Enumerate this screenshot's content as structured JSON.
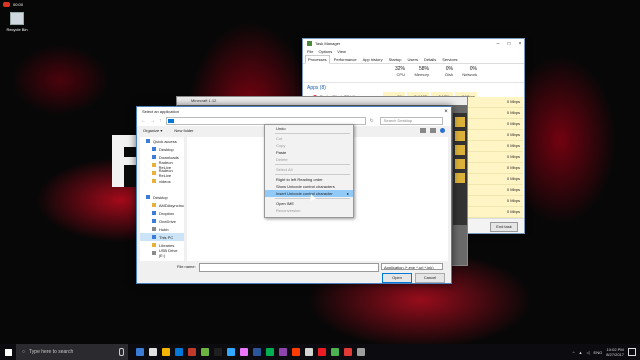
{
  "desktop": {
    "recorder_label": "00:00",
    "recycle_bin_label": "Recycle Bin"
  },
  "task_manager": {
    "title": "Task Manager",
    "menu": [
      "File",
      "Options",
      "View"
    ],
    "tabs": [
      "Processes",
      "Performance",
      "App history",
      "Startup",
      "Users",
      "Details",
      "Services"
    ],
    "columns": [
      {
        "pct": "32%",
        "label": "CPU"
      },
      {
        "pct": "58%",
        "label": "Memory"
      },
      {
        "pct": "0%",
        "label": "Disk"
      },
      {
        "pct": "0%",
        "label": "Network"
      }
    ],
    "group_label": "Apps (8)",
    "row": {
      "name": "EvolveClient (32 bit)",
      "cpu": "0%",
      "memory": "5.4 MB",
      "disk": "0 MB/s",
      "network": "0 Mbps"
    },
    "network_values": [
      "0 Mbps",
      "0 Mbps",
      "0 Mbps",
      "0 Mbps",
      "0 Mbps",
      "0 Mbps",
      "0 Mbps",
      "0 Mbps",
      "0 Mbps",
      "0 Mbps",
      "0 Mbps"
    ],
    "end_task_label": "End task"
  },
  "background_window": {
    "title": "Minecraft 1.12"
  },
  "dialog": {
    "title": "Select an application",
    "search_placeholder": "Search Desktop",
    "organize_label": "Organize ▾",
    "new_folder_label": "New folder",
    "nav_items": [
      {
        "label": "Quick access",
        "sub": false,
        "color": "blue"
      },
      {
        "label": "Desktop",
        "sub": true,
        "color": "blue"
      },
      {
        "label": "Downloads",
        "sub": true,
        "color": "blue"
      },
      {
        "label": "Radeon ReLive",
        "sub": true,
        "color": "yellow"
      },
      {
        "label": "Radeon ReLive",
        "sub": true,
        "color": "yellow"
      },
      {
        "label": "videos",
        "sub": true,
        "color": "yellow"
      },
      {
        "label": "",
        "sub": false,
        "color": "none"
      },
      {
        "label": "Desktop",
        "sub": false,
        "color": "blue"
      },
      {
        "label": "AMDAsyncInc",
        "sub": true,
        "color": "yellow"
      },
      {
        "label": "Dropbox",
        "sub": true,
        "color": "blue"
      },
      {
        "label": "OneDrive",
        "sub": true,
        "color": "blue"
      },
      {
        "label": "Hubb",
        "sub": true,
        "color": "grey"
      },
      {
        "label": "This PC",
        "sub": true,
        "color": "blue",
        "active": true
      },
      {
        "label": "Libraries",
        "sub": true,
        "color": "yellow"
      },
      {
        "label": "USB Drive (E:)",
        "sub": true,
        "color": "grey"
      }
    ],
    "file_name_label": "File name:",
    "file_type_value": "Application (*.exe *.url *.lnk)",
    "open_label": "Open",
    "cancel_label": "Cancel"
  },
  "context_menu": {
    "items": [
      {
        "label": "Undo",
        "state": "normal"
      },
      {
        "label": "",
        "state": "sep"
      },
      {
        "label": "Cut",
        "state": "disabled"
      },
      {
        "label": "Copy",
        "state": "disabled"
      },
      {
        "label": "Paste",
        "state": "normal"
      },
      {
        "label": "Delete",
        "state": "disabled"
      },
      {
        "label": "",
        "state": "sep"
      },
      {
        "label": "Select All",
        "state": "disabled"
      },
      {
        "label": "",
        "state": "sep"
      },
      {
        "label": "Right to left Reading order",
        "state": "normal"
      },
      {
        "label": "Show Unicode control characters",
        "state": "normal"
      },
      {
        "label": "Insert Unicode control character",
        "state": "highlight",
        "arrow": "▸"
      },
      {
        "label": "",
        "state": "sep"
      },
      {
        "label": "Open IME",
        "state": "normal"
      },
      {
        "label": "Reconversion",
        "state": "disabled"
      }
    ]
  },
  "taskbar": {
    "search_placeholder": "Type here to search",
    "app_icon_colors": [
      "#3a7bd5",
      "#e0e0e0",
      "#f5b400",
      "#0078d7",
      "#c0392b",
      "#6db33f",
      "#1f1f1f",
      "#31a8ff",
      "#ea77ff",
      "#2b579a",
      "#00b050",
      "#8e44ad",
      "#ff3d00",
      "#d4d4d4",
      "#ed1c24",
      "#4caf50",
      "#e53935",
      "#9e9e9e"
    ],
    "language": "ENG",
    "time": "10:02 PM",
    "date": "8/27/2017"
  },
  "colors": {
    "accent": "#0078d7",
    "context_highlight": "#91c9f7",
    "tm_usage_fill": "#fff4c4"
  }
}
